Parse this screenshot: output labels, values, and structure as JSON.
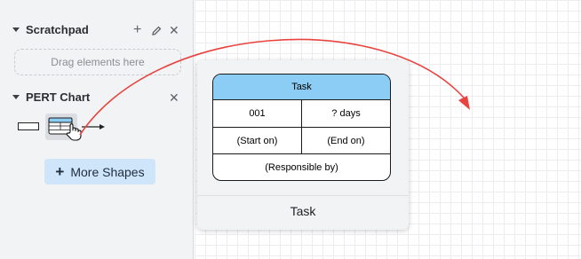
{
  "sidebar": {
    "scratchpad": {
      "title": "Scratchpad",
      "add_icon": "plus-icon",
      "edit_icon": "pencil-icon",
      "close_icon": "close-icon",
      "dropzone_text": "Drag elements here"
    },
    "pert": {
      "title": "PERT Chart",
      "close_icon": "close-icon",
      "shapes": [
        "rectangle-shape-icon",
        "task-table-shape-icon",
        "connector-arrow-icon"
      ]
    },
    "more_shapes_label": "More Shapes"
  },
  "preview": {
    "label": "Task",
    "task": {
      "title": "Task",
      "id": "001",
      "duration": "? days",
      "start": "(Start on)",
      "end": "(End on)",
      "responsible": "(Responsible by)"
    }
  },
  "colors": {
    "sidebar_bg": "#f1f3f4",
    "button_bg": "#cfe5fa",
    "task_header": "#8ccdf5",
    "arrow": "#e8433f"
  }
}
